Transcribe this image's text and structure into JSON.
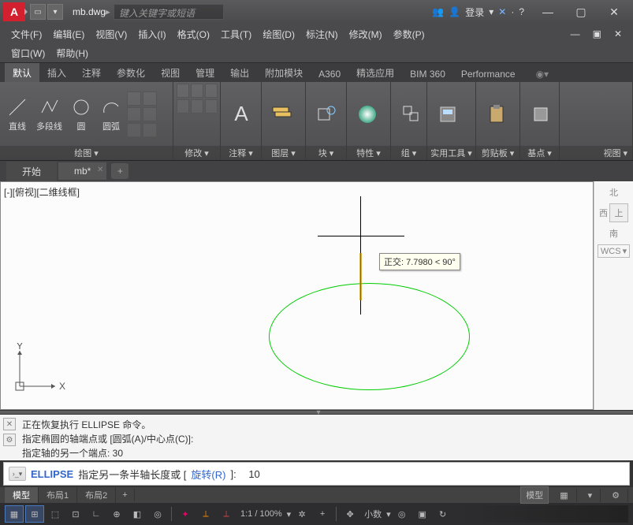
{
  "title": {
    "filename": "mb.dwg",
    "search_placeholder": "键入关键字或短语",
    "login": "登录"
  },
  "menu": {
    "items": [
      "文件(F)",
      "编辑(E)",
      "视图(V)",
      "插入(I)",
      "格式(O)",
      "工具(T)",
      "绘图(D)",
      "标注(N)",
      "修改(M)",
      "参数(P)"
    ],
    "items2": [
      "窗口(W)",
      "帮助(H)"
    ]
  },
  "ribtabs": [
    "默认",
    "插入",
    "注释",
    "参数化",
    "视图",
    "管理",
    "输出",
    "附加模块",
    "A360",
    "精选应用",
    "BIM 360",
    "Performance"
  ],
  "ribbon": {
    "draw": {
      "line": "直线",
      "pline": "多段线",
      "circle": "圆",
      "arc": "圆弧",
      "label": "绘图"
    },
    "modify": {
      "label": "修改"
    },
    "annot": {
      "label": "注释"
    },
    "layer": {
      "label": "图层"
    },
    "block": {
      "label": "块"
    },
    "prop": {
      "label": "特性"
    },
    "group": {
      "label": "组"
    },
    "util": {
      "label": "实用工具"
    },
    "clip": {
      "label": "剪贴板"
    },
    "base": {
      "label": "基点"
    },
    "view": {
      "label": "视图"
    }
  },
  "filetabs": {
    "start": "开始",
    "file": "mb*"
  },
  "viewport": {
    "label": "[-][俯视][二维线框]",
    "tooltip": "正交: 7.7980 < 90°",
    "north": "北",
    "west": "西",
    "up": "上",
    "south": "南",
    "wcs": "WCS",
    "axis_x": "X",
    "axis_y": "Y"
  },
  "cmd_history": {
    "l1": "正在恢复执行 ELLIPSE 命令。",
    "l2": "指定椭圆的轴端点或 [圆弧(A)/中心点(C)]:",
    "l3": "指定轴的另一个端点: 30"
  },
  "cmdline": {
    "cmd": "ELLIPSE",
    "prompt": "指定另一条半轴长度或 [",
    "opt": "旋转(R)",
    "tail": "]:",
    "input": "10"
  },
  "layout": {
    "model": "模型",
    "l1": "布局1",
    "l2": "布局2",
    "model_btn": "模型"
  },
  "status": {
    "zoom": "1:1 / 100%",
    "decimal": "小数"
  }
}
